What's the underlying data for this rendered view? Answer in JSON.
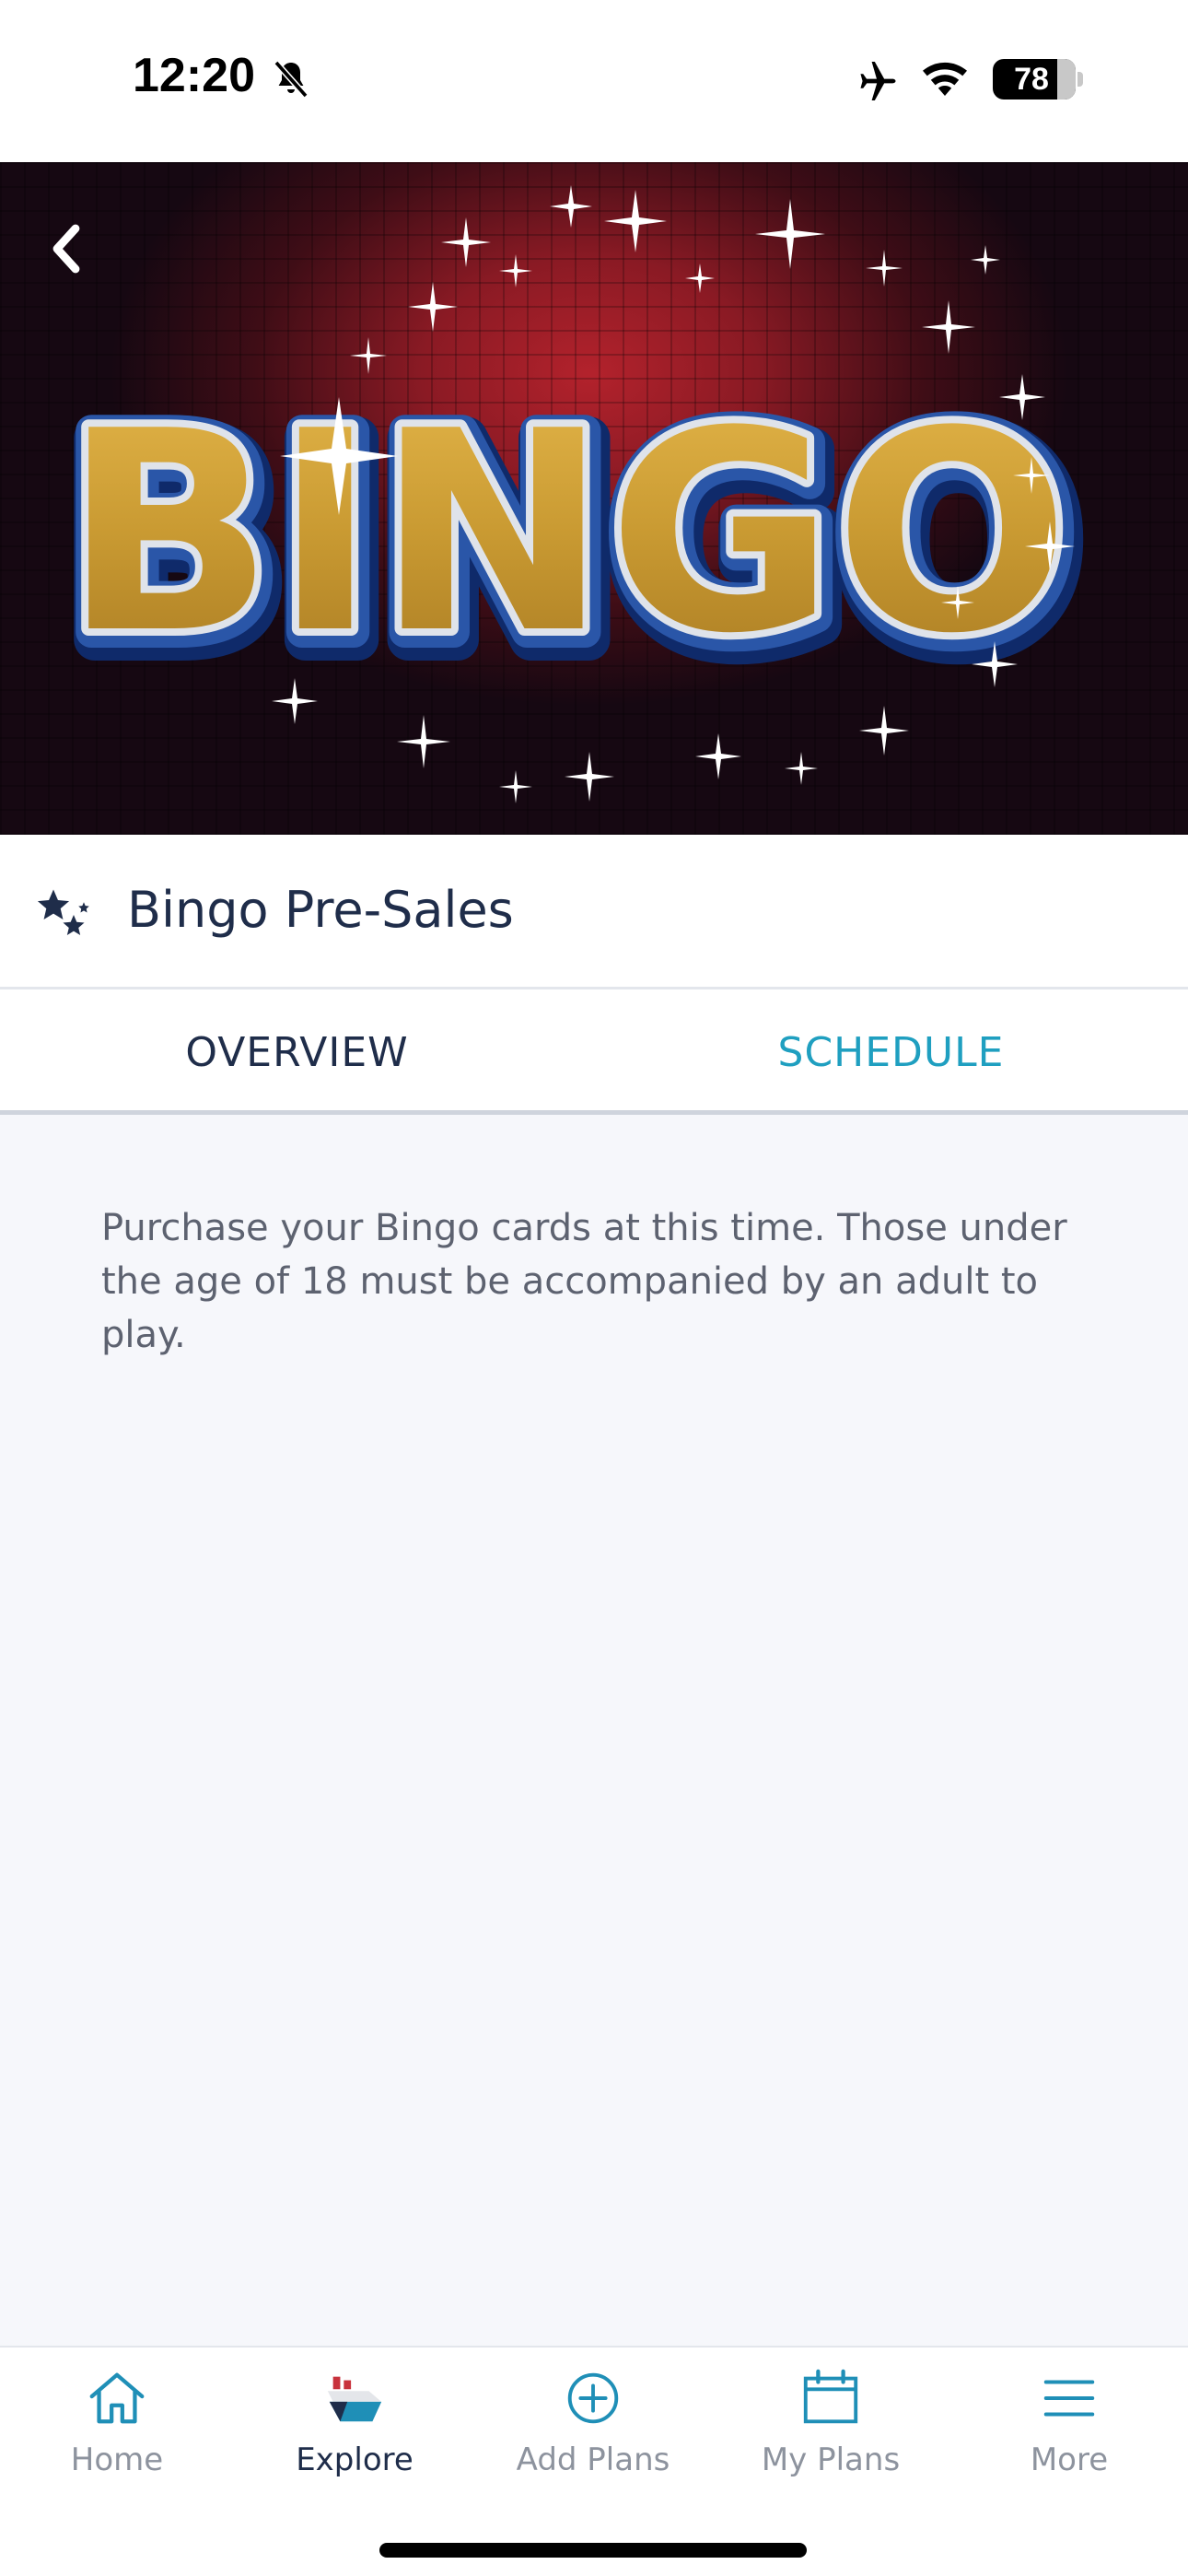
{
  "status_bar": {
    "time": "12:20",
    "battery": "78",
    "battery_level": 0.78,
    "icons": [
      "bell-slash-icon",
      "airplane-icon",
      "wifi-icon",
      "battery-icon"
    ]
  },
  "hero": {
    "image_text": "BINGO",
    "back_icon": "chevron-left-icon"
  },
  "event": {
    "title": "Bingo Pre-Sales",
    "icon": "stars-icon"
  },
  "tabs": [
    {
      "label": "OVERVIEW",
      "selected": false
    },
    {
      "label": "SCHEDULE",
      "selected": true
    }
  ],
  "description": "Purchase your Bingo cards at this time. Those under the age of 18 must be accompanied by an adult to play.",
  "nav": {
    "items": [
      {
        "label": "Home",
        "icon": "house-icon",
        "active": false
      },
      {
        "label": "Explore",
        "icon": "ship-icon",
        "active": true
      },
      {
        "label": "Add Plans",
        "icon": "plus-circle-icon",
        "active": false
      },
      {
        "label": "My Plans",
        "icon": "calendar-icon",
        "active": false
      },
      {
        "label": "More",
        "icon": "menu-icon",
        "active": false
      }
    ]
  },
  "colors": {
    "navy": "#1f2d4a",
    "accent": "#1f9fc0",
    "muted": "#8d939e",
    "background": "#f6f7fb"
  }
}
